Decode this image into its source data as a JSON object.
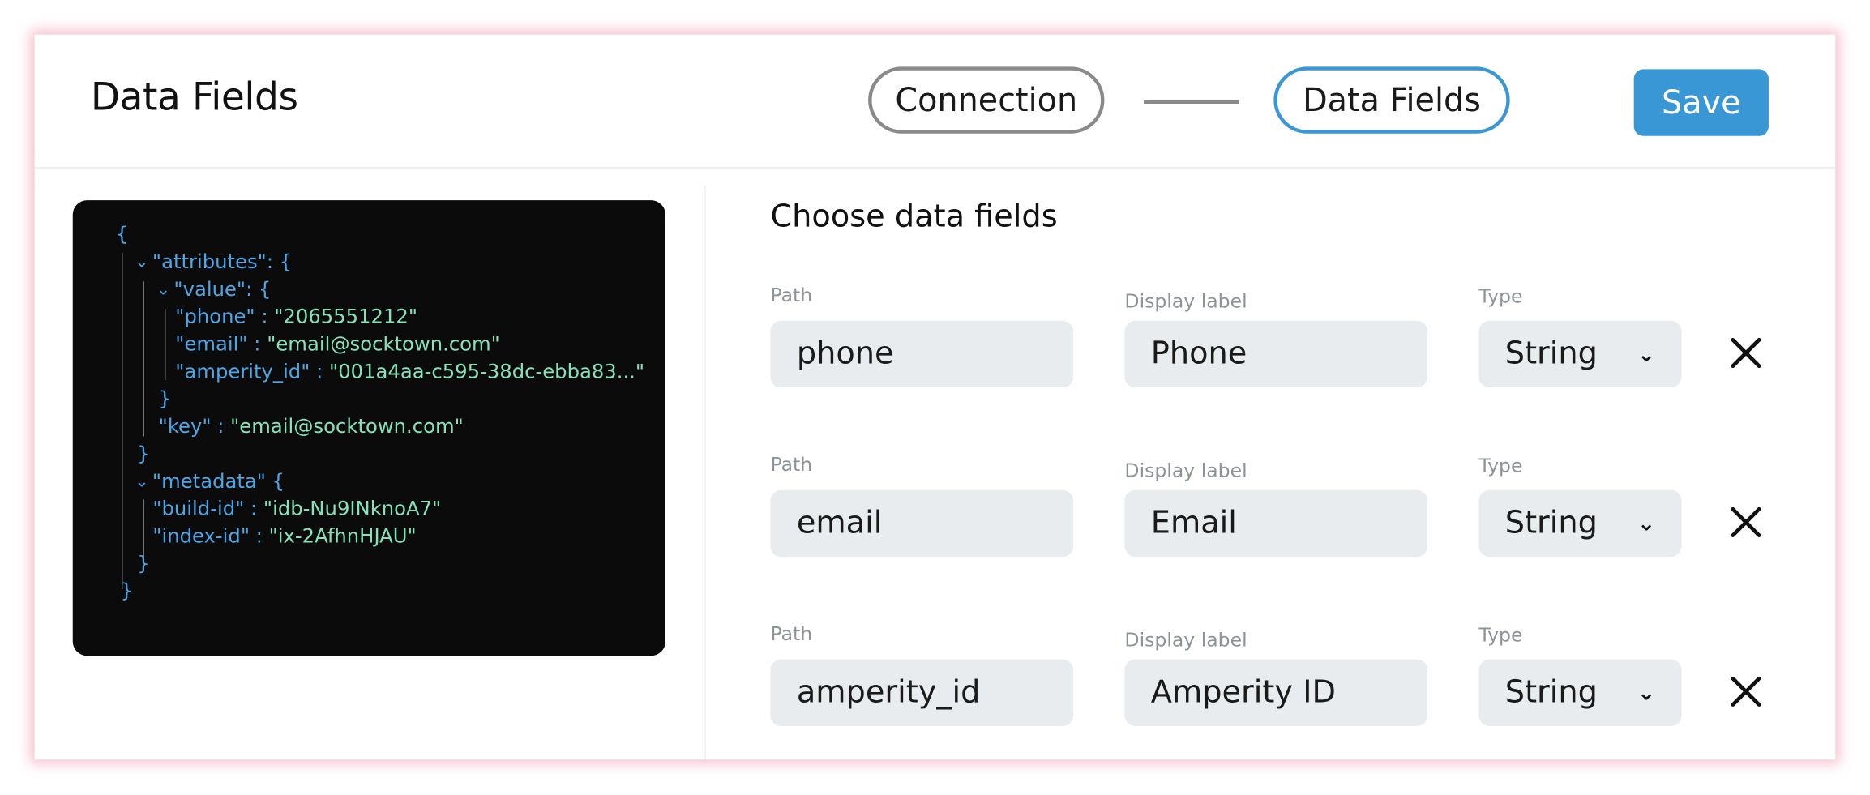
{
  "header": {
    "title": "Data Fields",
    "steps": [
      "Connection",
      "Data Fields"
    ],
    "save_label": "Save"
  },
  "colors": {
    "accent": "#3a97d6",
    "code_bg": "#0b0b0c",
    "code_key": "#4da6e6",
    "code_string": "#86e3b9",
    "input_bg": "#e9ecee"
  },
  "icons": [
    "chevron-down-icon",
    "close-icon"
  ],
  "code": {
    "open_brace": "{",
    "close_brace": "}",
    "attributes_key": "\"attributes\"",
    "value_key": "\"value\"",
    "phone_key": "\"phone\"",
    "phone_val": "\"2065551212\"",
    "email_key": "\"email\"",
    "email_val": "\"email@socktown.com\"",
    "amperity_key": "\"amperity_id\"",
    "amperity_val": "\"001a4aa-c595-38dc-ebba83...\"",
    "key_key": "\"key\"",
    "key_val": "\"email@socktown.com\"",
    "metadata_key": "\"metadata\"",
    "build_key": "\"build-id\"",
    "build_val": "\"idb-Nu9INknoA7\"",
    "index_key": "\"index-id\"",
    "index_val": "\"ix-2AfhnHJAU\""
  },
  "fields_section": {
    "title": "Choose data fields",
    "path_label": "Path",
    "display_label": "Display label",
    "type_label": "Type",
    "rows": [
      {
        "path": "phone",
        "display": "Phone",
        "type": "String"
      },
      {
        "path": "email",
        "display": "Email",
        "type": "String"
      },
      {
        "path": "amperity_id",
        "display": "Amperity ID",
        "type": "String"
      }
    ]
  }
}
